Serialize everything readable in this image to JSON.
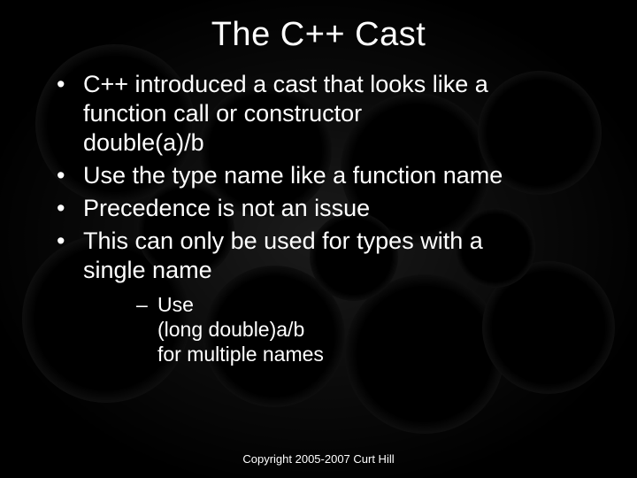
{
  "title": "The C++ Cast",
  "bullets": [
    {
      "lines": [
        "C++ introduced a cast that looks like a",
        "function call or constructor",
        "double(a)/b"
      ]
    },
    {
      "lines": [
        "Use the type name like a function name"
      ]
    },
    {
      "lines": [
        "Precedence is not an issue"
      ]
    },
    {
      "lines": [
        "This can only be used for types with a",
        "single name"
      ],
      "sub": [
        {
          "lines": [
            "Use",
            "(long double)a/b",
            "for multiple names"
          ]
        }
      ]
    }
  ],
  "footer": "Copyright 2005-2007 Curt Hill"
}
